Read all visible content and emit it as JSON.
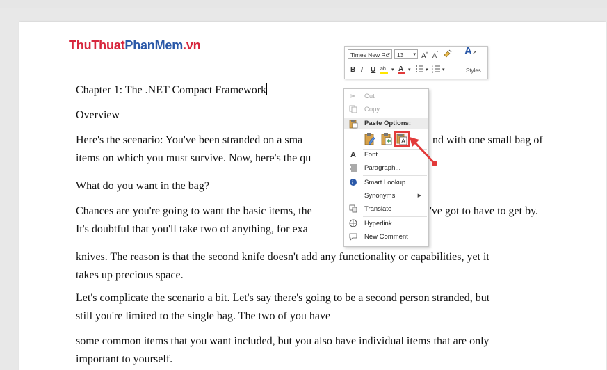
{
  "logo": {
    "part1": "ThuThuat",
    "part2": "PhanMem",
    "part3": ".vn"
  },
  "document": {
    "lines": [
      {
        "text": "Chapter 1: The .NET Compact Framework",
        "top": 0
      },
      {
        "text": "Overview"
      },
      {
        "text": "Here's the scenario: You've been stranded on a sma"
      },
      {
        "text": "items on which you must survive. Now, here's the qu"
      },
      {
        "text": "What do you want in the bag?"
      },
      {
        "text": "Chances are you're going to want the basic items, the"
      },
      {
        "text": "It's doubtful that you'll take two of anything, for exa"
      }
    ],
    "line_right_1": "nd with one small bag of",
    "line_right_2": "'ve got to have to get by.",
    "p_knives_1": "knives. The reason is that the second knife doesn't add any functionality or capabilities, yet it",
    "p_knives_2": "takes up precious space.",
    "p_complicate_1": "Let's complicate the scenario a bit. Let's say there's going to be a second person stranded, but",
    "p_complicate_2": "still you're limited to the single bag. The two of you have",
    "p_common_1": "some common items that you want included, but you also have individual items that are only",
    "p_common_2": "important to yourself."
  },
  "mini_toolbar": {
    "font_name": "Times New Rc",
    "font_size": "13",
    "styles_label": "Styles",
    "bold": "B",
    "italic": "I",
    "underline": "U"
  },
  "context_menu": {
    "cut": "Cut",
    "copy": "Copy",
    "paste_options": "Paste Options:",
    "font": "Font...",
    "paragraph": "Paragraph...",
    "smart_lookup": "Smart Lookup",
    "synonyms": "Synonyms",
    "translate": "Translate",
    "hyperlink": "Hyperlink...",
    "new_comment": "New Comment"
  },
  "colors": {
    "highlight_red": "#e23a3a",
    "logo_red": "#d7263d",
    "logo_blue": "#2a58a8"
  }
}
